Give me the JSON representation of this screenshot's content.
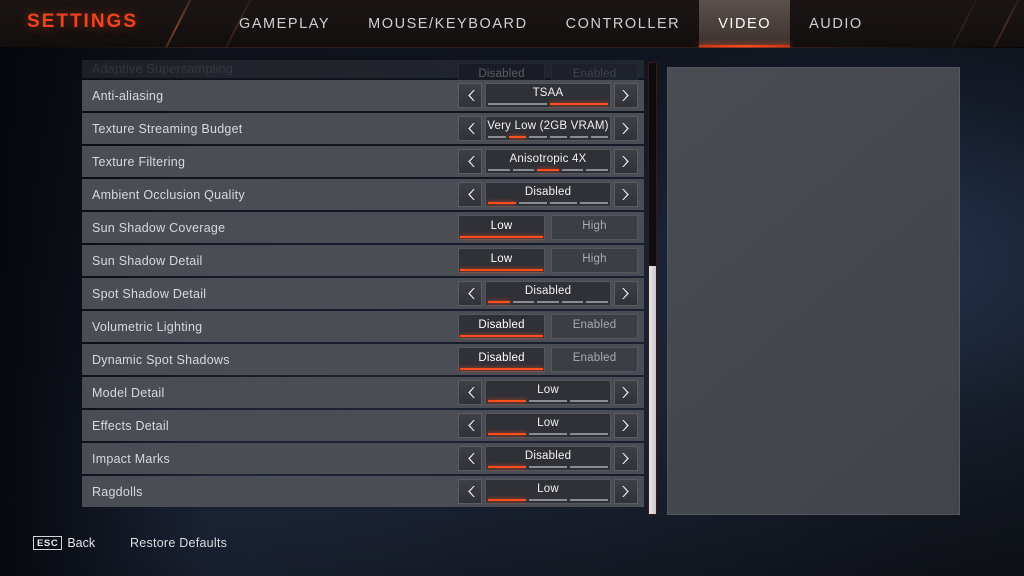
{
  "header": {
    "brand": "SETTINGS",
    "tabs": [
      {
        "label": "GAMEPLAY",
        "active": false
      },
      {
        "label": "MOUSE/KEYBOARD",
        "active": false
      },
      {
        "label": "CONTROLLER",
        "active": false
      },
      {
        "label": "VIDEO",
        "active": true
      },
      {
        "label": "AUDIO",
        "active": false
      }
    ],
    "accent_color": "#ff4d1e",
    "brand_color": "#f1441b"
  },
  "settings": {
    "rows": [
      {
        "label": "Adaptive Supersampling",
        "type": "toggle",
        "clipped": true,
        "options": [
          "Disabled",
          "Enabled"
        ],
        "selected_index": 0
      },
      {
        "label": "Anti-aliasing",
        "type": "stepper",
        "value": "TSAA",
        "segments": 2,
        "segment_index": 1,
        "prev_icon": "chevron-left-icon",
        "next_icon": "chevron-right-icon"
      },
      {
        "label": "Texture Streaming Budget",
        "type": "stepper",
        "value": "Very Low (2GB VRAM)",
        "segments": 6,
        "segment_index": 1,
        "prev_icon": "chevron-left-icon",
        "next_icon": "chevron-right-icon"
      },
      {
        "label": "Texture Filtering",
        "type": "stepper",
        "value": "Anisotropic 4X",
        "segments": 5,
        "segment_index": 2,
        "prev_icon": "chevron-left-icon",
        "next_icon": "chevron-right-icon"
      },
      {
        "label": "Ambient Occlusion Quality",
        "type": "stepper",
        "value": "Disabled",
        "segments": 4,
        "segment_index": 0,
        "prev_icon": "chevron-left-icon",
        "next_icon": "chevron-right-icon"
      },
      {
        "label": "Sun Shadow Coverage",
        "type": "toggle",
        "options": [
          "Low",
          "High"
        ],
        "selected_index": 0
      },
      {
        "label": "Sun Shadow Detail",
        "type": "toggle",
        "options": [
          "Low",
          "High"
        ],
        "selected_index": 0
      },
      {
        "label": "Spot Shadow Detail",
        "type": "stepper",
        "value": "Disabled",
        "segments": 5,
        "segment_index": 0,
        "prev_icon": "chevron-left-icon",
        "next_icon": "chevron-right-icon"
      },
      {
        "label": "Volumetric Lighting",
        "type": "toggle",
        "options": [
          "Disabled",
          "Enabled"
        ],
        "selected_index": 0
      },
      {
        "label": "Dynamic Spot Shadows",
        "type": "toggle",
        "options": [
          "Disabled",
          "Enabled"
        ],
        "selected_index": 0
      },
      {
        "label": "Model Detail",
        "type": "stepper",
        "value": "Low",
        "segments": 3,
        "segment_index": 0,
        "prev_icon": "chevron-left-icon",
        "next_icon": "chevron-right-icon"
      },
      {
        "label": "Effects Detail",
        "type": "stepper",
        "value": "Low",
        "segments": 3,
        "segment_index": 0,
        "prev_icon": "chevron-left-icon",
        "next_icon": "chevron-right-icon"
      },
      {
        "label": "Impact Marks",
        "type": "stepper",
        "value": "Disabled",
        "segments": 3,
        "segment_index": 0,
        "prev_icon": "chevron-left-icon",
        "next_icon": "chevron-right-icon"
      },
      {
        "label": "Ragdolls",
        "type": "stepper",
        "value": "Low",
        "segments": 3,
        "segment_index": 0,
        "prev_icon": "chevron-left-icon",
        "next_icon": "chevron-right-icon"
      }
    ]
  },
  "scrollbar": {
    "thumb_top_pct": 45,
    "thumb_height_pct": 55
  },
  "preview": {
    "label": "settings-preview-panel"
  },
  "footer": {
    "back_key": "ESC",
    "back_label": "Back",
    "restore_label": "Restore Defaults"
  }
}
